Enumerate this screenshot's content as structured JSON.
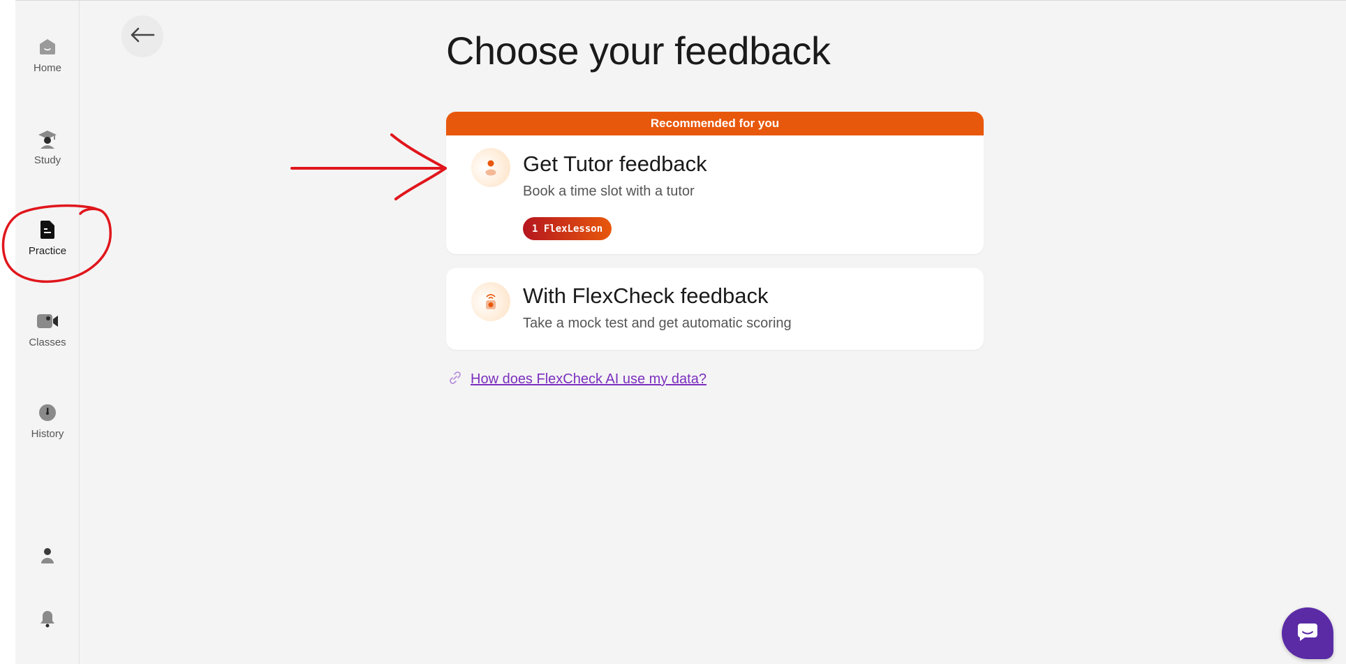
{
  "sidebar": {
    "items": [
      {
        "label": "Home",
        "icon": "home-icon"
      },
      {
        "label": "Study",
        "icon": "graduation-cap-icon"
      },
      {
        "label": "Practice",
        "icon": "document-icon",
        "active": true
      },
      {
        "label": "Classes",
        "icon": "video-camera-icon"
      },
      {
        "label": "History",
        "icon": "clock-icon"
      }
    ],
    "profile_icon": "user-icon",
    "notifications_icon": "bell-icon"
  },
  "header": {
    "back_icon": "arrow-left-icon",
    "title": "Choose your feedback"
  },
  "options": {
    "tutor": {
      "banner": "Recommended for you",
      "title": "Get Tutor feedback",
      "subtitle": "Book a time slot with a tutor",
      "badge": "1 FlexLesson",
      "icon": "tutor-icon"
    },
    "flexcheck": {
      "title": "With FlexCheck feedback",
      "subtitle": "Take a mock test and get automatic scoring",
      "icon": "robot-icon"
    }
  },
  "data_link": {
    "label": "How does FlexCheck AI use my data?",
    "icon": "link-icon"
  },
  "colors": {
    "accent_orange": "#e8580c",
    "badge_red": "#b5161f",
    "link_purple": "#7b2fbe",
    "chat_purple": "#5b2ba6",
    "annotation_red": "#e0161c"
  },
  "chat": {
    "icon": "chat-icon"
  }
}
